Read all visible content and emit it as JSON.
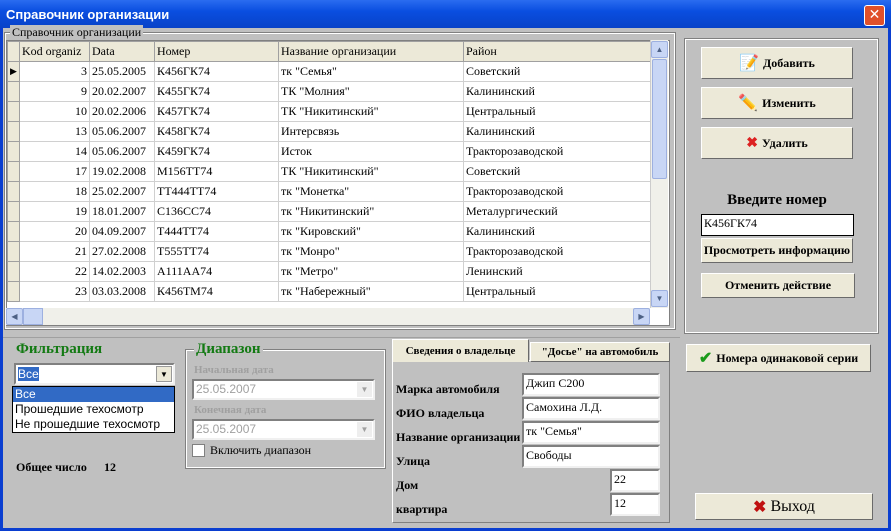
{
  "window": {
    "title": "Справочник организации",
    "close": "✕"
  },
  "grid": {
    "group_title": "Справочник организации",
    "columns": [
      "Kod organiz",
      "Data",
      "Номер",
      "Название организации",
      "Район"
    ],
    "rows": [
      [
        "3",
        "25.05.2005",
        "К456ГК74",
        "тк \"Семья\"",
        "Советский"
      ],
      [
        "9",
        "20.02.2007",
        "К455ГК74",
        "ТК \"Молния\"",
        "Калининский"
      ],
      [
        "10",
        "20.02.2006",
        "К457ГК74",
        "ТК \"Никитинский\"",
        "Центральный"
      ],
      [
        "13",
        "05.06.2007",
        "К458ГК74",
        "Интерсвязь",
        "Калининский"
      ],
      [
        "14",
        "05.06.2007",
        "К459ГК74",
        "Исток",
        "Тракторозаводской"
      ],
      [
        "17",
        "19.02.2008",
        "М156ТТ74",
        "ТК \"Никитинский\"",
        "Советский"
      ],
      [
        "18",
        "25.02.2007",
        "ТТ444ТТ74",
        "тк \"Монетка\"",
        "Тракторозаводской"
      ],
      [
        "19",
        "18.01.2007",
        "С136СС74",
        "тк \"Никитинский\"",
        "Металургический"
      ],
      [
        "20",
        "04.09.2007",
        "Т444ТТ74",
        "тк \"Кировский\"",
        "Калининский"
      ],
      [
        "21",
        "27.02.2008",
        "Т555ТТ74",
        "тк \"Монро\"",
        "Тракторозаводской"
      ],
      [
        "22",
        "14.02.2003",
        "А111АА74",
        "тк \"Метро\"",
        "Ленинский"
      ],
      [
        "23",
        "03.03.2008",
        "К456ТМ74",
        "тк \"Набережный\"",
        "Центральный"
      ]
    ],
    "selected_row": 0
  },
  "actions": {
    "add": "Добавить",
    "edit": "Изменить",
    "delete": "Удалить",
    "enter_number_label": "Введите номер",
    "number_value": "К456ГК74",
    "view_info": "Просмотреть информацию",
    "undo": "Отменить действие",
    "same_series": "Номера одинаковой серии",
    "exit": "Выход"
  },
  "filter": {
    "title": "Фильтрация",
    "selected": "Все",
    "options": [
      "Все",
      "Прошедшие техосмотр",
      "Не прошедшие техосмотр"
    ],
    "total_label": "Общее число",
    "total_value": "12"
  },
  "range": {
    "title": "Диапазон",
    "start_label": "Начальная дата",
    "start_value": "25.05.2007",
    "end_label": "Конечная дата",
    "end_value": "25.05.2007",
    "enable_label": "Включить диапазон"
  },
  "tabs": {
    "owner": "Сведения о владельце",
    "dossier": "\"Досье\" на автомобиль"
  },
  "owner": {
    "car_label": "Марка автомобиля",
    "car": "Джип С200",
    "fio_label": "ФИО владельца",
    "fio": "Самохина Л.Д.",
    "org_label": "Название организации",
    "org": "тк \"Семья\"",
    "street_label": "Улица",
    "street": "Свободы",
    "house_label": "Дом",
    "house": "22",
    "flat_label": "квартира",
    "flat": "12"
  },
  "colors": {
    "title_bar": "#0a4ee0",
    "green": "#137a13",
    "selection": "#316ac5"
  }
}
